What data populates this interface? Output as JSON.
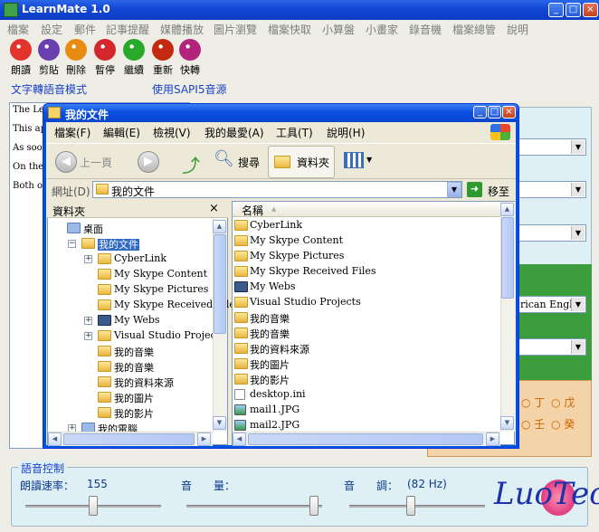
{
  "app": {
    "title": "LearnMate 1.0"
  },
  "menu": [
    "檔案",
    "設定",
    "郵件",
    "記事提醒",
    "媒體播放",
    "圖片瀏覽",
    "檔案快取",
    "小算盤",
    "小畫家",
    "錄音機",
    "檔案總管",
    "說明"
  ],
  "toolbar": [
    {
      "label": "朗讀",
      "icon": "lips-icon",
      "color": "#e2332d"
    },
    {
      "label": "剪貼",
      "icon": "clipboard-icon",
      "color": "#6a3fb0"
    },
    {
      "label": "刪除",
      "icon": "delete-icon",
      "color": "#e88b12"
    },
    {
      "label": "暫停",
      "icon": "pause-icon",
      "color": "#d4262d"
    },
    {
      "label": "繼續",
      "icon": "continue-icon",
      "color": "#2aa82a"
    },
    {
      "label": "重新",
      "icon": "restart-icon",
      "color": "#c42a12"
    },
    {
      "label": "快轉",
      "icon": "fastforward-icon",
      "color": "#b3237c"
    }
  ],
  "mode": {
    "left": "文字轉語音模式",
    "right": "使用SAPI5音源"
  },
  "textbox": [
    "The Le choosin file.",
    "This ap speech operati mode. selectin",
    "As soon spoken may se",
    "On the conver audio f",
    "Both o screen. you the"
  ],
  "right_panel": {
    "combo_language": "rican Engli"
  },
  "radios": [
    {
      "label": "丁",
      "row": 1
    },
    {
      "label": "戊",
      "row": 1
    },
    {
      "label": "壬",
      "row": 2
    },
    {
      "label": "癸",
      "row": 2
    }
  ],
  "voice": {
    "legend": "語音控制",
    "rate_label": "朗讀速率：",
    "rate_value": "155",
    "volume_label": "音　　量：",
    "pitch_label": "音　　調：",
    "pitch_value": "(82 Hz)",
    "rate_level": 0.5,
    "volume_level": 0.97,
    "pitch_level": 0.45
  },
  "logo": {
    "text": "LuoTec"
  },
  "explorer": {
    "title": "我的文件",
    "menu": [
      "檔案(F)",
      "編輯(E)",
      "檢視(V)",
      "我的最愛(A)",
      "工具(T)",
      "說明(H)"
    ],
    "toolbar": {
      "back": "上一頁",
      "search": "搜尋",
      "folders": "資料夾"
    },
    "address": {
      "label": "網址(D)",
      "value": "我的文件",
      "go": "移至"
    },
    "folders_pane": {
      "title": "資料夾"
    },
    "tree": [
      {
        "label": "桌面",
        "level": 0,
        "expander": "",
        "icon": "sys"
      },
      {
        "label": "我的文件",
        "level": 1,
        "expander": "−",
        "icon": "folder",
        "selected": true
      },
      {
        "label": "CyberLink",
        "level": 2,
        "expander": "+",
        "icon": "folder"
      },
      {
        "label": "My Skype Content",
        "level": 2,
        "expander": "",
        "icon": "folder"
      },
      {
        "label": "My Skype Pictures",
        "level": 2,
        "expander": "",
        "icon": "folder"
      },
      {
        "label": "My Skype Received Files",
        "level": 2,
        "expander": "",
        "icon": "folder"
      },
      {
        "label": "My Webs",
        "level": 2,
        "expander": "+",
        "icon": "dark"
      },
      {
        "label": "Visual Studio Projects",
        "level": 2,
        "expander": "+",
        "icon": "folder"
      },
      {
        "label": "我的音樂",
        "level": 2,
        "expander": "",
        "icon": "music"
      },
      {
        "label": "我的音樂",
        "level": 2,
        "expander": "",
        "icon": "folder"
      },
      {
        "label": "我的資料來源",
        "level": 2,
        "expander": "",
        "icon": "music"
      },
      {
        "label": "我的圖片",
        "level": 2,
        "expander": "",
        "icon": "music"
      },
      {
        "label": "我的影片",
        "level": 2,
        "expander": "",
        "icon": "music"
      },
      {
        "label": "我的電腦",
        "level": 1,
        "expander": "+",
        "icon": "sys"
      }
    ],
    "list_header": {
      "name": "名稱"
    },
    "files": [
      {
        "label": "CyberLink",
        "icon": "folder"
      },
      {
        "label": "My Skype Content",
        "icon": "folder"
      },
      {
        "label": "My Skype Pictures",
        "icon": "folder"
      },
      {
        "label": "My Skype Received Files",
        "icon": "folder"
      },
      {
        "label": "My Webs",
        "icon": "dark"
      },
      {
        "label": "Visual Studio Projects",
        "icon": "folder"
      },
      {
        "label": "我的音樂",
        "icon": "music"
      },
      {
        "label": "我的音樂",
        "icon": "folder"
      },
      {
        "label": "我的資料來源",
        "icon": "music"
      },
      {
        "label": "我的圖片",
        "icon": "music"
      },
      {
        "label": "我的影片",
        "icon": "music"
      },
      {
        "label": "desktop.ini",
        "icon": "file"
      },
      {
        "label": "mail1.JPG",
        "icon": "image"
      },
      {
        "label": "mail2.JPG",
        "icon": "image"
      }
    ]
  }
}
